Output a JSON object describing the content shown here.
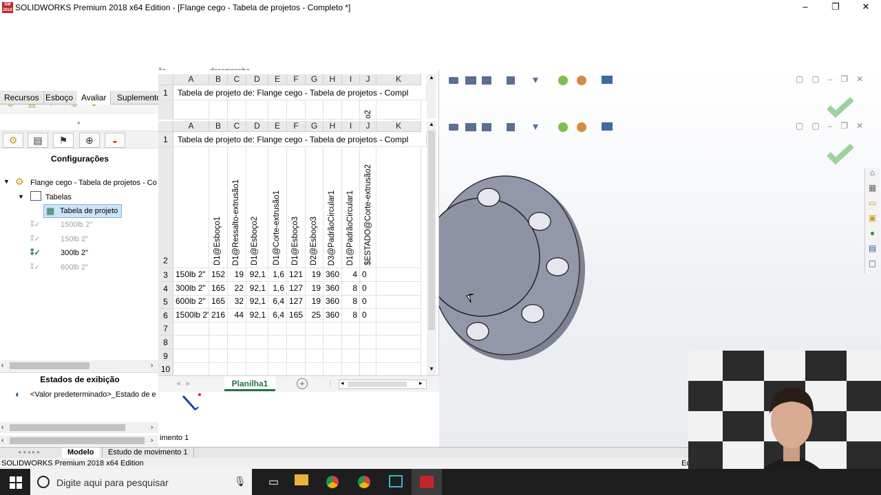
{
  "window": {
    "title": "SOLIDWORKS Premium 2018 x64 Edition - [Flange cego - Tabela de projetos - Completo *]",
    "minimize": "–",
    "restore": "❐",
    "close": "✕"
  },
  "ribbon_tabs": [
    "Recursos",
    "Esboço",
    "Avaliar",
    "Suplemento"
  ],
  "ghost_text": {
    "a": "ão",
    "b": "desempenho"
  },
  "config_panel": {
    "title": "Configurações",
    "root": "Flange cego - Tabela de projetos - Co",
    "tables": "Tabelas",
    "design_table": "Tabela de projeto",
    "configs": [
      {
        "label": "1500lb 2\"",
        "active": false
      },
      {
        "label": "150lb 2\"",
        "active": false
      },
      {
        "label": "300lb 2\"",
        "active": true
      },
      {
        "label": "600lb 2\"",
        "active": false
      }
    ]
  },
  "display_states": {
    "title": "Estados de exibição",
    "item": "<Valor predeterminado>_Estado de e"
  },
  "bottom_tabs": [
    "Modelo",
    "Estudo de movimento 1"
  ],
  "motion_partial": "imento 1",
  "status_text": "SOLIDWORKS Premium 2018 x64 Edition",
  "status_right": "Ed",
  "taskbar": {
    "search_placeholder": "Digite aqui para pesquisar"
  },
  "excel": {
    "columns": [
      "A",
      "B",
      "C",
      "D",
      "E",
      "F",
      "G",
      "H",
      "I",
      "J",
      "K"
    ],
    "title_row": "Tabela de projeto de: Flange cego - Tabela de projetos - Compl",
    "params": [
      "D1@Esboço1",
      "D1@Ressalto-extrusão1",
      "D1@Esboço2",
      "D1@Corte-extrusão1",
      "D1@Esboço3",
      "D2@Esboço3",
      "D3@PadrãoCircular1",
      "D1@PadrãoCircular1",
      "$ESTADO@Corte-extrusão2"
    ],
    "ghost_param": "o2",
    "rows": [
      {
        "n": "3",
        "cells": [
          "150lb 2\"",
          "152",
          "19",
          "92,1",
          "1,6",
          "121",
          "19",
          "360",
          "4",
          "0"
        ]
      },
      {
        "n": "4",
        "cells": [
          "300lb 2\"",
          "165",
          "22",
          "92,1",
          "1,6",
          "127",
          "19",
          "360",
          "8",
          "0"
        ]
      },
      {
        "n": "5",
        "cells": [
          "600lb 2\"",
          "165",
          "32",
          "92,1",
          "6,4",
          "127",
          "19",
          "360",
          "8",
          "0"
        ]
      },
      {
        "n": "6",
        "cells": [
          "1500lb 2\"",
          "216",
          "44",
          "92,1",
          "6,4",
          "165",
          "25",
          "360",
          "8",
          "0"
        ]
      }
    ],
    "empty_rows": [
      "7",
      "8",
      "9",
      "10"
    ],
    "row_labels": {
      "r1": "1",
      "r2": "2"
    },
    "sheet_tab": "Planilha1"
  },
  "colors": {
    "accent": "#217346",
    "check": "#9ed19b",
    "part": "#8e93a4"
  }
}
